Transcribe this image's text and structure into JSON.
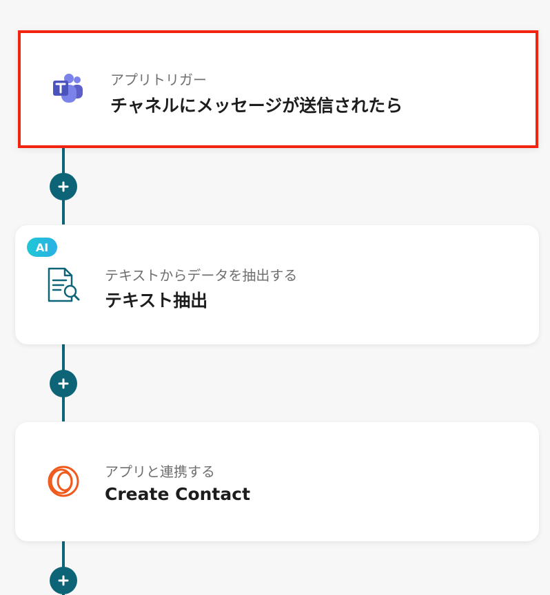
{
  "flow": {
    "steps": [
      {
        "subtitle": "アプリトリガー",
        "title": "チャネルにメッセージが送信されたら",
        "icon": "microsoft-teams-icon",
        "selected": true
      },
      {
        "badge": "AI",
        "subtitle": "テキストからデータを抽出する",
        "title": "テキスト抽出",
        "icon": "document-search-icon"
      },
      {
        "subtitle": "アプリと連携する",
        "title": "Create Contact",
        "icon": "loop-rings-icon"
      }
    ],
    "add_button_icon": "plus-icon"
  },
  "colors": {
    "connector": "#0d6477",
    "selected_border": "#f2230f",
    "ai_badge": "#1fc7d4",
    "teams_purple": "#5b5fc7",
    "doc_icon": "#0d6477",
    "loop_orange": "#f05a1c"
  }
}
